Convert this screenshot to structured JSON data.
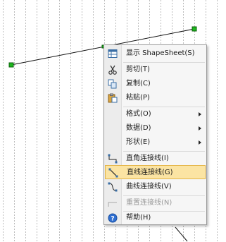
{
  "menu": {
    "items": [
      {
        "label": "显示 ShapeSheet(S)",
        "icon": "shapesheet-icon"
      },
      {
        "label": "剪切(T)",
        "icon": "scissors-icon"
      },
      {
        "label": "复制(C)",
        "icon": "copy-icon"
      },
      {
        "label": "粘贴(P)",
        "icon": "paste-icon"
      },
      {
        "label": "格式(O)",
        "submenu": true
      },
      {
        "label": "数据(D)",
        "submenu": true
      },
      {
        "label": "形状(E)",
        "submenu": true
      },
      {
        "label": "直角连接线(I)",
        "icon": "right-angle-connector-icon"
      },
      {
        "label": "直线连接线(G)",
        "icon": "straight-connector-icon",
        "highlighted": true
      },
      {
        "label": "曲线连接线(V)",
        "icon": "curved-connector-icon"
      },
      {
        "label": "重置连接线(N)",
        "icon": "reset-connector-icon",
        "disabled": true
      },
      {
        "label": "帮助(H)",
        "icon": "help-icon"
      }
    ]
  },
  "colors": {
    "handle": "#1eb81e",
    "highlight": "#fbe4a3",
    "help": "#2f6fd1"
  }
}
